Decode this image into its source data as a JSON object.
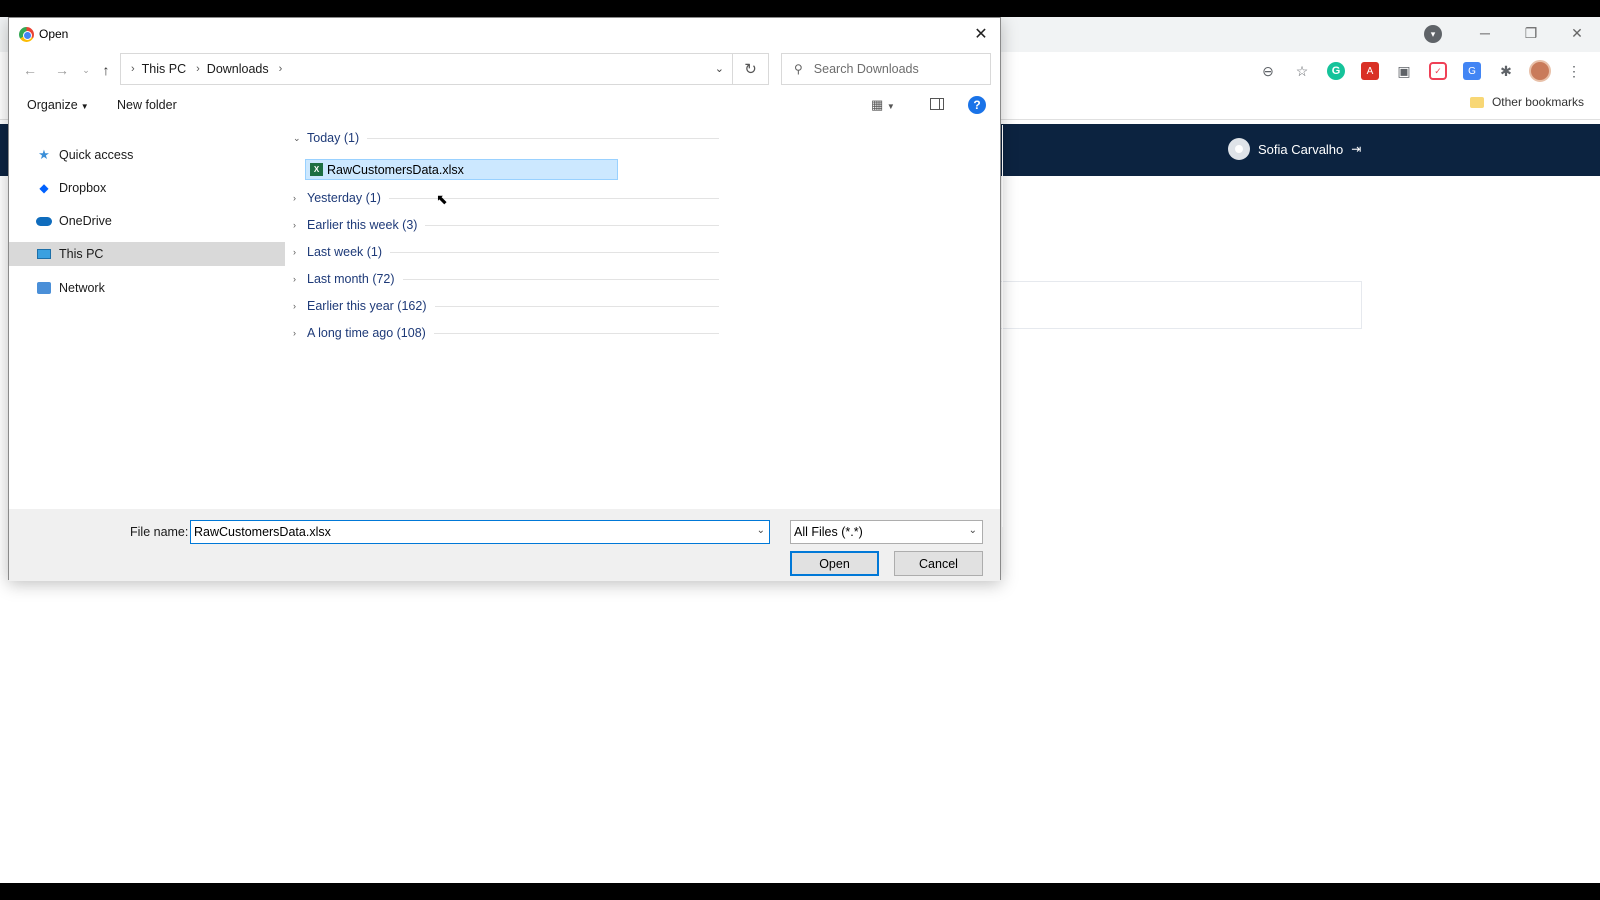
{
  "browser": {
    "other_bookmarks": "Other bookmarks",
    "user_name": "Sofia Carvalho",
    "icons": [
      "zoom-out-icon",
      "star-icon",
      "grammarly-icon",
      "pdf-icon",
      "readwise-icon",
      "pocket-icon",
      "translate-icon",
      "extensions-icon",
      "profile-avatar",
      "more-menu-icon"
    ]
  },
  "dialog": {
    "title": "Open",
    "path": [
      "This PC",
      "Downloads"
    ],
    "search_placeholder": "Search Downloads",
    "toolbar": {
      "organize": "Organize",
      "new_folder": "New folder"
    },
    "nav_items": [
      {
        "label": "Quick access",
        "icon": "star-icon"
      },
      {
        "label": "Dropbox",
        "icon": "dropbox-icon"
      },
      {
        "label": "OneDrive",
        "icon": "cloud-icon"
      },
      {
        "label": "This PC",
        "icon": "computer-icon",
        "selected": true
      },
      {
        "label": "Network",
        "icon": "network-icon"
      }
    ],
    "groups": [
      {
        "label": "Today (1)",
        "expanded": true
      },
      {
        "label": "Yesterday (1)",
        "expanded": false
      },
      {
        "label": "Earlier this week (3)",
        "expanded": false
      },
      {
        "label": "Last week (1)",
        "expanded": false
      },
      {
        "label": "Last month (72)",
        "expanded": false
      },
      {
        "label": "Earlier this year (162)",
        "expanded": false
      },
      {
        "label": "A long time ago (108)",
        "expanded": false
      }
    ],
    "selected_file": "RawCustomersData.xlsx",
    "file_name_label": "File name:",
    "file_name_value": "RawCustomersData.xlsx",
    "file_type": "All Files (*.*)",
    "open_button": "Open",
    "cancel_button": "Cancel"
  },
  "colors": {
    "selection": "#cce8ff",
    "accent": "#0078d7",
    "app_header": "#0c2340",
    "group_text": "#1e3a78"
  }
}
